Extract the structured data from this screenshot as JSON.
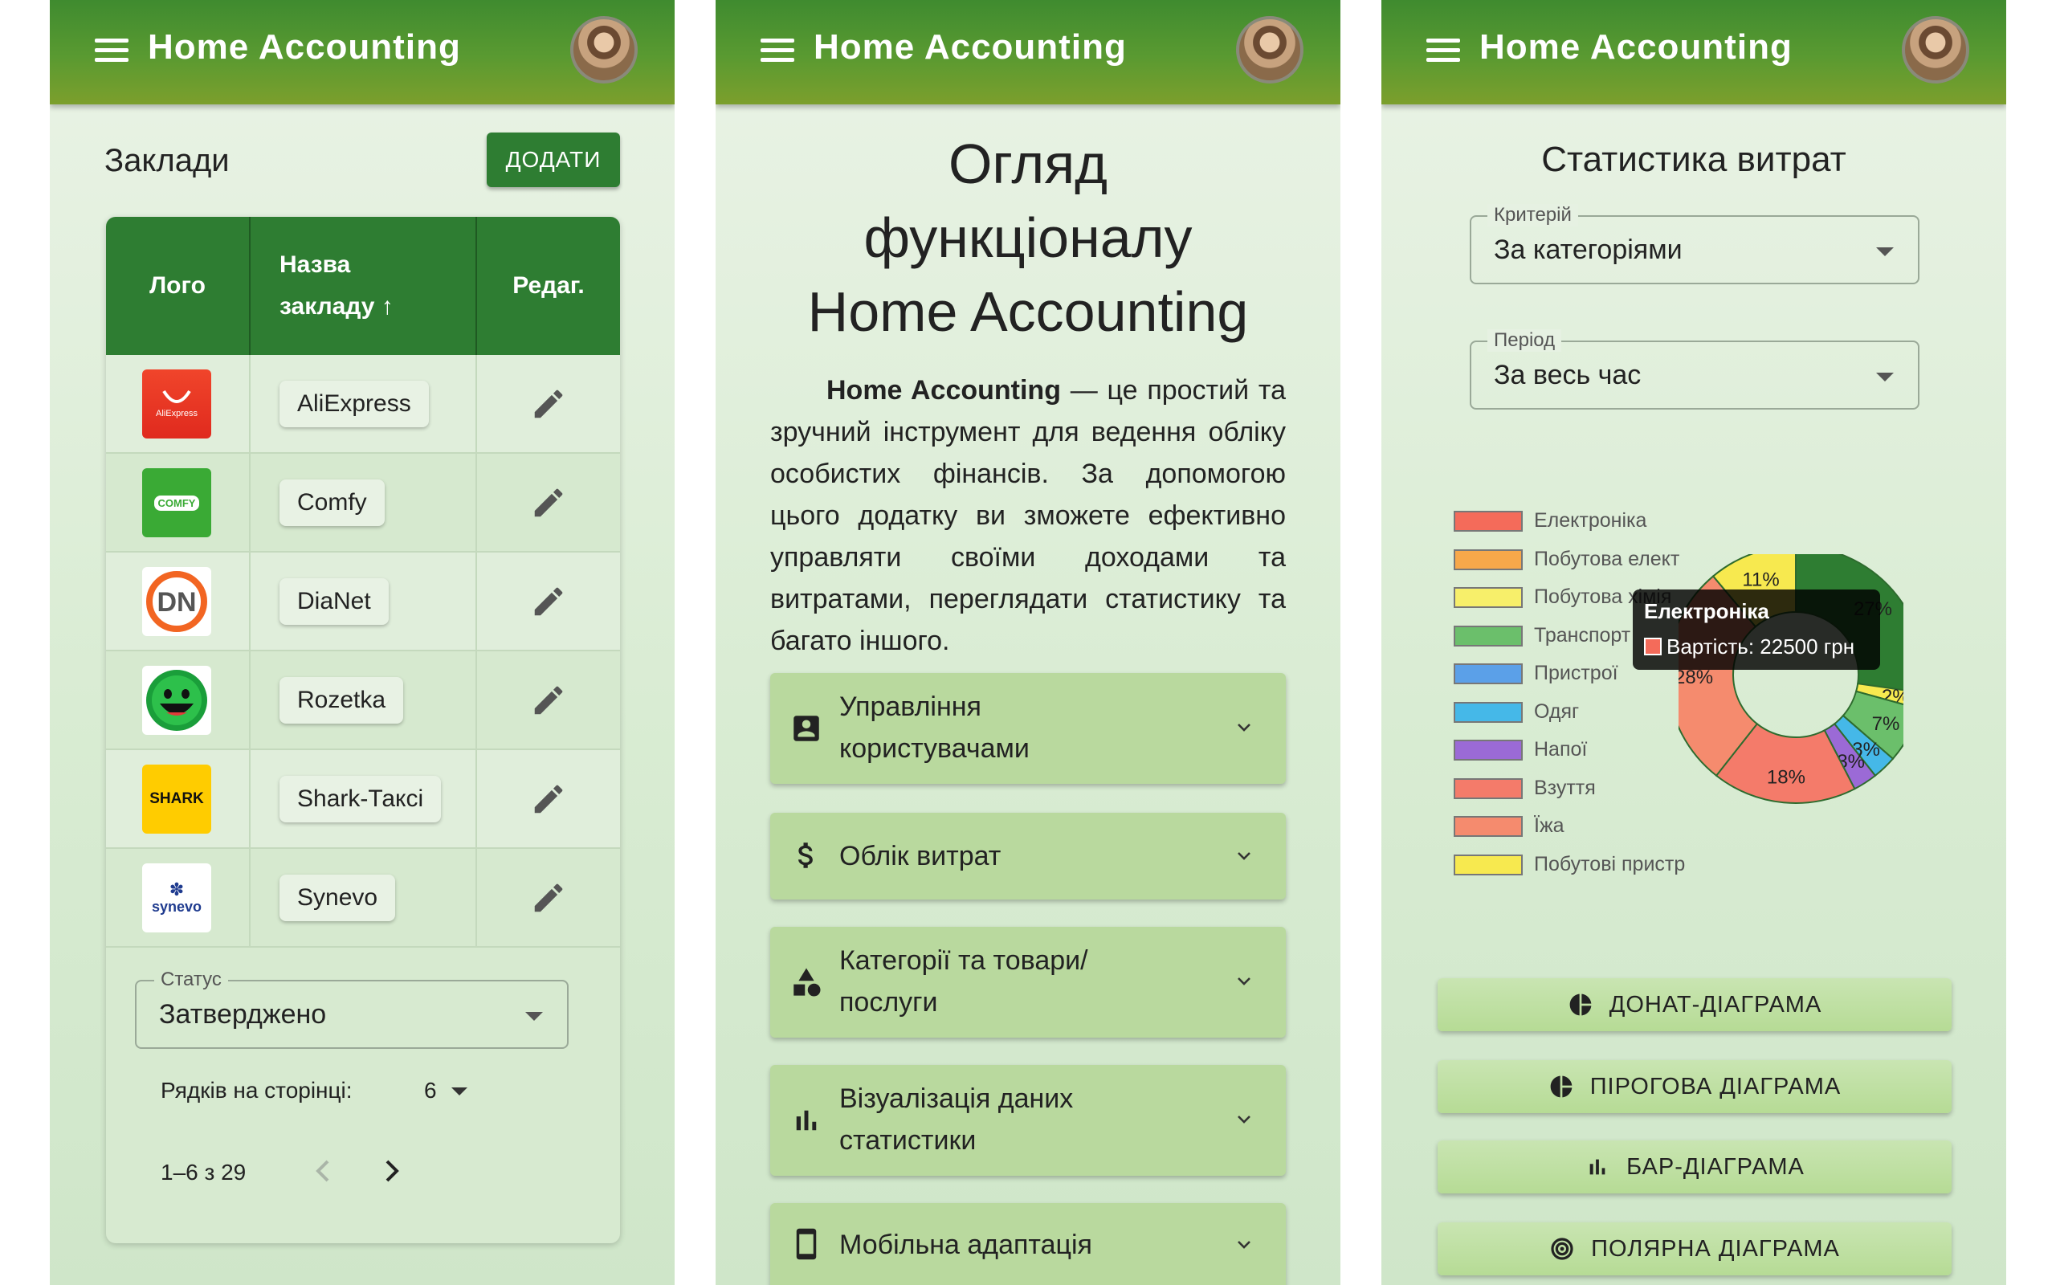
{
  "app": {
    "title": "Home Accounting"
  },
  "panel1": {
    "title": "Заклади",
    "add_label": "ДОДАТИ",
    "columns": {
      "logo": "Лого",
      "name_line1": "Назва",
      "name_line2": "закладу ↑",
      "edit": "Редаг."
    },
    "rows": [
      {
        "name": "AliExpress",
        "logo_text": "AliExpress"
      },
      {
        "name": "Comfy",
        "logo_text": "COMFY"
      },
      {
        "name": "DiaNet",
        "logo_text": "DN"
      },
      {
        "name": "Rozetka",
        "logo_text": ""
      },
      {
        "name": "Shark-Таксі",
        "logo_text": "SHARK"
      },
      {
        "name": "Synevo",
        "logo_text": "synevo"
      }
    ],
    "status_label": "Статус",
    "status_value": "Затверджено",
    "rows_per_page_label": "Рядків на сторінці:",
    "rows_per_page_value": "6",
    "pagination_text": "1–6 з 29"
  },
  "panel2": {
    "heading_line1": "Огляд",
    "heading_line2": "функціоналу",
    "heading_line3": "Home Accounting",
    "intro_bold": "Home Accounting",
    "intro_rest": " — це простий та зручний інструмент для ведення обліку особистих фінансів. За допомогою цього додатку ви зможете ефективно управляти своїми доходами та витратами, переглядати статистику та багато іншого.",
    "sections": [
      {
        "line1": "Управління",
        "line2": "користувачами",
        "icon": "account-box-icon"
      },
      {
        "line1": "Облік витрат",
        "line2": "",
        "icon": "dollar-icon"
      },
      {
        "line1": "Категорії та товари/",
        "line2": "послуги",
        "icon": "category-icon"
      },
      {
        "line1": "Візуалізація даних",
        "line2": "статистики",
        "icon": "bar-chart-icon"
      },
      {
        "line1": "Мобільна адаптація",
        "line2": "",
        "icon": "smartphone-icon"
      }
    ]
  },
  "panel3": {
    "title": "Статистика витрат",
    "criterion_label": "Критерій",
    "criterion_value": "За категоріями",
    "period_label": "Період",
    "period_value": "За весь час",
    "tooltip_title": "Електроніка",
    "tooltip_value": "Вартість: 22500 грн",
    "buttons": [
      {
        "label": "ДОНАТ-ДІАГРАМА",
        "icon": "pie-chart-icon"
      },
      {
        "label": "ПІРОГОВА ДІАГРАМА",
        "icon": "pie-chart-icon"
      },
      {
        "label": "БАР-ДІАГРАМА",
        "icon": "bar-chart-icon"
      },
      {
        "label": "ПОЛЯРНА ДІАГРАМА",
        "icon": "polar-chart-icon"
      }
    ]
  },
  "chart_data": {
    "type": "pie",
    "variant": "donut",
    "categories": [
      "Електроніка",
      "Побутова елект",
      "Побутова хімія",
      "Транспорт",
      "Пристрої",
      "Одяг",
      "Напої",
      "Взуття",
      "Їжа",
      "Побутові пристр"
    ],
    "colors": [
      "#2e7d32",
      "#f7e94f",
      "#f47b6a",
      "#f58b6e",
      "#9b6ad6",
      "#45b8e8",
      "#5ba0e8",
      "#6bbf6b",
      "#f7e94f",
      "#2e7d32"
    ],
    "legend_colors": [
      "#f46b5a",
      "#f7a84a",
      "#f7ef6a",
      "#6bbf6b",
      "#5ba0e8",
      "#45b8e8",
      "#9b6ad6",
      "#f47b6a",
      "#f58b6e",
      "#f7e94f"
    ],
    "slices": [
      {
        "label": "27%",
        "value": 27,
        "color": "#2e7d32"
      },
      {
        "label": "2%",
        "value": 2,
        "color": "#f7e94f"
      },
      {
        "label": "7%",
        "value": 7,
        "color": "#6bbf6b"
      },
      {
        "label": "3%",
        "value": 3,
        "color": "#45b8e8"
      },
      {
        "label": "3%",
        "value": 3,
        "color": "#9b6ad6"
      },
      {
        "label": "18%",
        "value": 18,
        "color": "#f47b6a"
      },
      {
        "label": "28%",
        "value": 28,
        "color": "#f58b6e"
      },
      {
        "label": "11%",
        "value": 11,
        "color": "#f7e94f"
      }
    ],
    "tooltip": {
      "category": "Електроніка",
      "value": 22500,
      "unit": "грн"
    }
  }
}
